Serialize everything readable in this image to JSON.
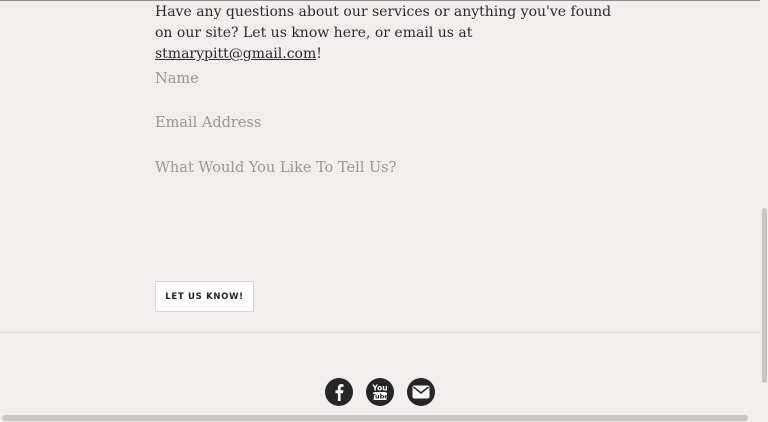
{
  "intro": {
    "text": "Have any questions about our services or anything you've found on our site? Let us know here, or email us at ",
    "email_link": "stmarypitt@gmail.com",
    "suffix": "!"
  },
  "form": {
    "name_placeholder": "Name",
    "email_placeholder": "Email Address",
    "message_placeholder": "What Would You Like To Tell Us?",
    "submit_label": "LET US KNOW!"
  },
  "social": [
    {
      "name": "facebook-icon",
      "glyph": "f"
    },
    {
      "name": "youtube-icon",
      "glyph_top": "You",
      "glyph_bottom": "Tube"
    },
    {
      "name": "email-icon"
    }
  ],
  "colors": {
    "background": "#f3eeee",
    "text": "#2a2a2a",
    "placeholder": "#9a9696",
    "icon_bg": "#262626"
  }
}
